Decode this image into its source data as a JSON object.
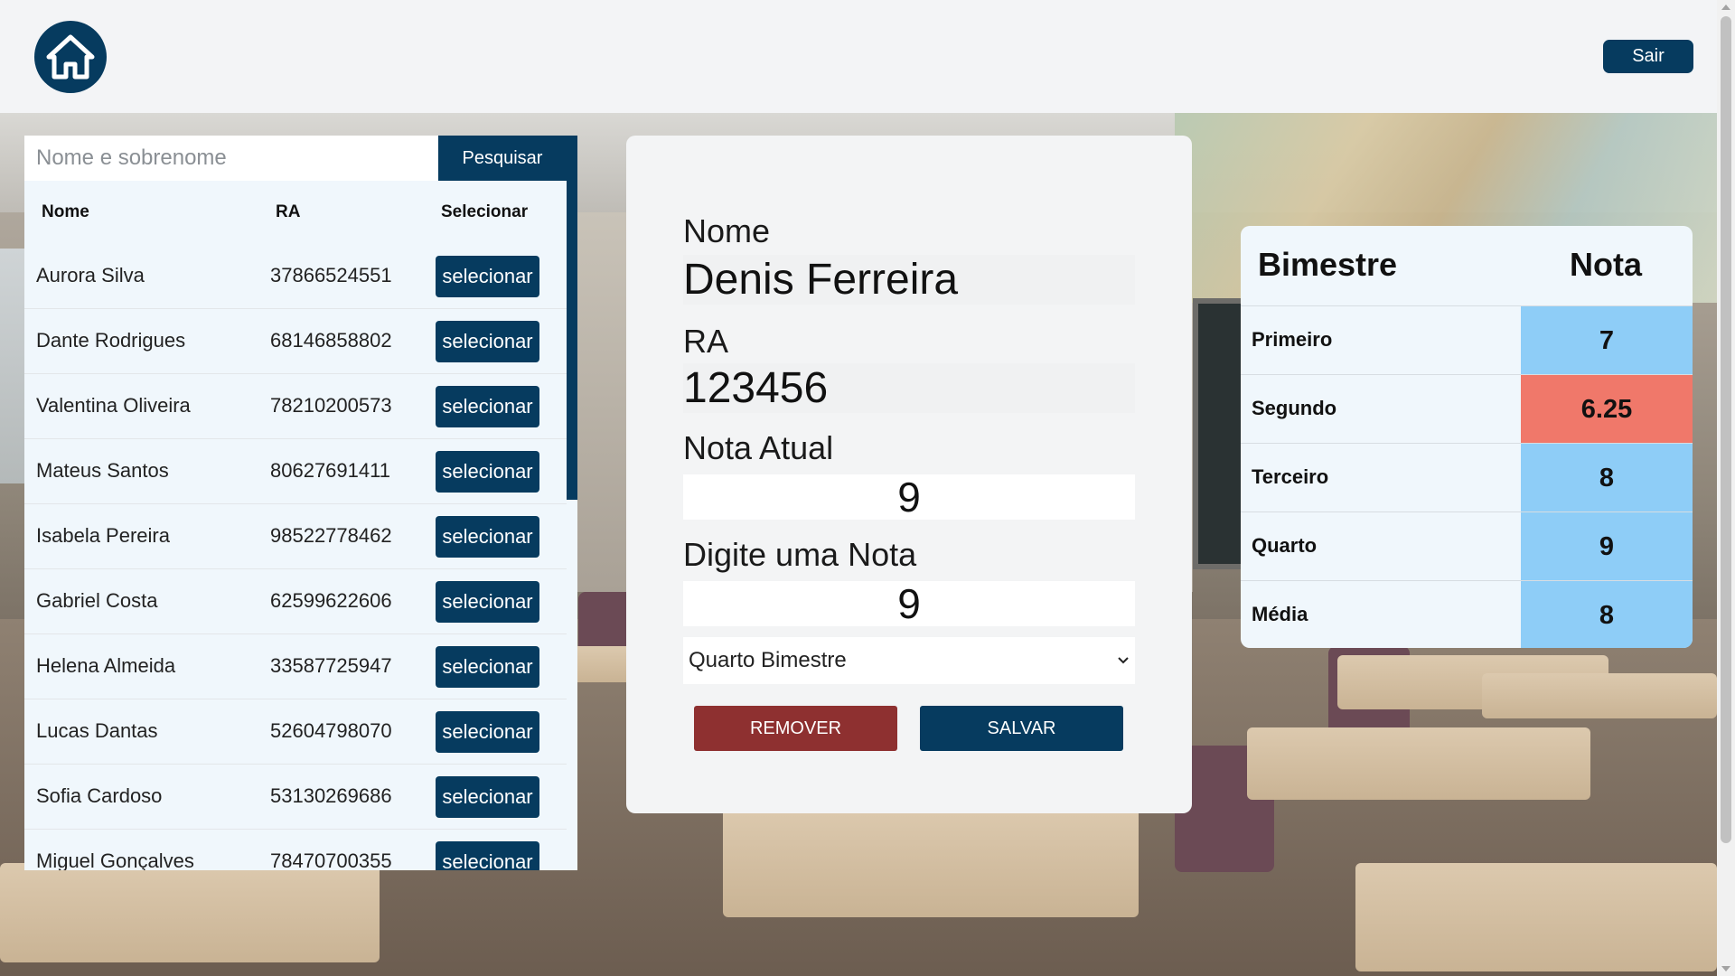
{
  "header": {
    "home_icon": "home-icon",
    "logout_label": "Sair"
  },
  "colors": {
    "primary": "#063b5f",
    "danger": "#8e3030",
    "grade_ok": "#8ecdf7",
    "grade_low": "#f0786a"
  },
  "search": {
    "placeholder": "Nome e sobrenome",
    "button_label": "Pesquisar"
  },
  "students_table": {
    "columns": [
      "Nome",
      "RA",
      "Selecionar"
    ],
    "button_label": "selecionar",
    "rows": [
      {
        "name": "Aurora Silva",
        "ra": "37866524551"
      },
      {
        "name": "Dante Rodrigues",
        "ra": "68146858802"
      },
      {
        "name": "Valentina Oliveira",
        "ra": "78210200573"
      },
      {
        "name": "Mateus Santos",
        "ra": "80627691411"
      },
      {
        "name": "Isabela Pereira",
        "ra": "98522778462"
      },
      {
        "name": "Gabriel Costa",
        "ra": "62599622606"
      },
      {
        "name": "Helena Almeida",
        "ra": "33587725947"
      },
      {
        "name": "Lucas Dantas",
        "ra": "52604798070"
      },
      {
        "name": "Sofia Cardoso",
        "ra": "53130269686"
      },
      {
        "name": "Miguel Gonçalves",
        "ra": "78470700355"
      }
    ]
  },
  "student_card": {
    "name_label": "Nome",
    "name_value": "Denis Ferreira",
    "ra_label": "RA",
    "ra_value": "123456",
    "current_grade_label": "Nota Atual",
    "current_grade_value": "9",
    "enter_grade_label": "Digite uma Nota",
    "enter_grade_value": "9",
    "term_select_value": "Quarto Bimestre",
    "remove_label": "REMOVER",
    "save_label": "SALVAR"
  },
  "grades_table": {
    "header_term": "Bimestre",
    "header_grade": "Nota",
    "rows": [
      {
        "term": "Primeiro",
        "grade": "7",
        "status": "ok"
      },
      {
        "term": "Segundo",
        "grade": "6.25",
        "status": "low"
      },
      {
        "term": "Terceiro",
        "grade": "8",
        "status": "ok"
      },
      {
        "term": "Quarto",
        "grade": "9",
        "status": "ok"
      },
      {
        "term": "Média",
        "grade": "8",
        "status": "ok"
      }
    ]
  }
}
